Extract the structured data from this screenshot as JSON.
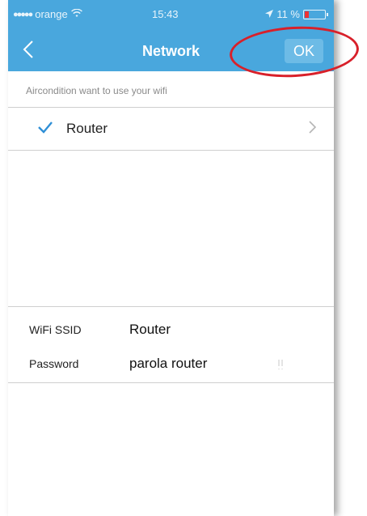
{
  "status_bar": {
    "carrier": "orange",
    "signal_dots": "●●●●●",
    "wifi_icon": "wifi-icon",
    "time": "15:43",
    "battery_percent": "11 %",
    "location_icon": "location-arrow-icon"
  },
  "nav": {
    "back_icon": "chevron-left-icon",
    "title": "Network",
    "ok_label": "OK"
  },
  "hint": "Aircondition want to use your wifi",
  "network_row": {
    "check_icon": "checkmark-icon",
    "label": "Router",
    "chevron_icon": "chevron-right-icon"
  },
  "form": {
    "ssid_label": "WiFi SSID",
    "ssid_value": "Router",
    "password_label": "Password",
    "password_value": "parola router",
    "toggle_icon": "show-password-icon"
  },
  "colors": {
    "header": "#49a7dd",
    "ok_button": "#6dbbe6",
    "check": "#2f8fd6",
    "annotation": "#d8202a"
  }
}
